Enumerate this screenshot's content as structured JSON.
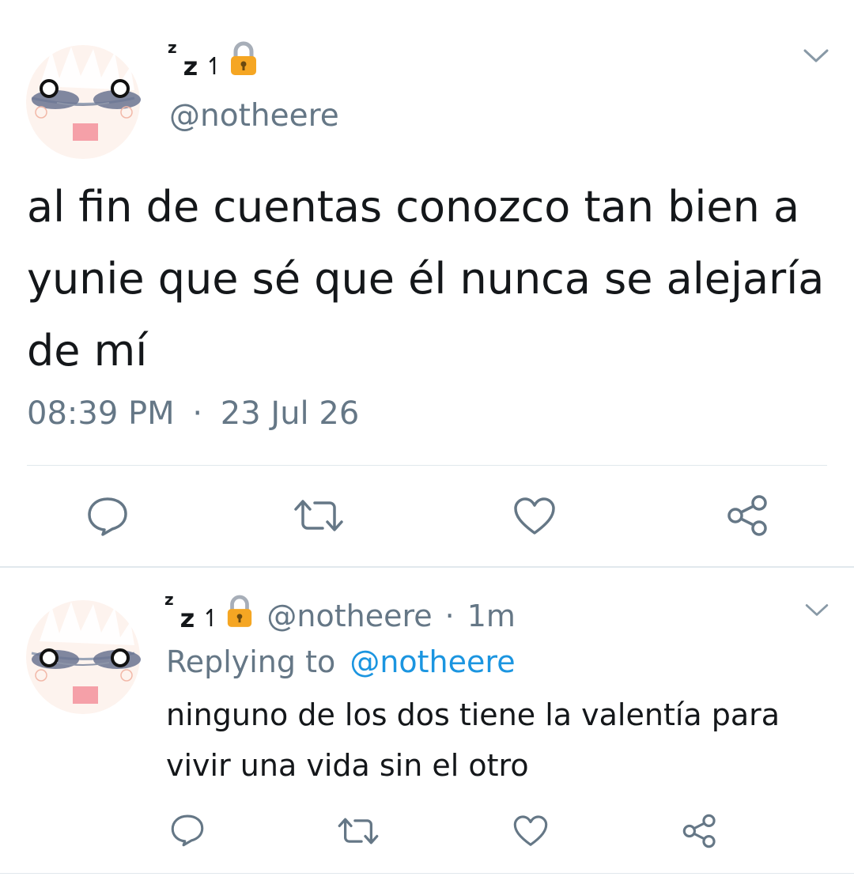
{
  "tweet": {
    "display_name_sup": "z",
    "display_name_main": "z",
    "display_name_arrow": "↿",
    "handle": "@notheere",
    "text": "al fin de cuentas conozco tan bien a yunie que sé que él nunca se alejaría de mí",
    "time": "08:39 PM",
    "separator": "·",
    "date": "23 Jul 26",
    "icons": {
      "menu": "chevron-down-icon",
      "reply": "reply-icon",
      "retweet": "retweet-icon",
      "like": "heart-icon",
      "share": "share-icon"
    }
  },
  "reply": {
    "display_name_sup": "z",
    "display_name_main": "z",
    "display_name_arrow": "↿",
    "handle": "@notheere",
    "separator": "·",
    "time_ago": "1m",
    "replying_prefix": "Replying to",
    "replying_handle": "@notheere",
    "text": "ninguno de los dos tiene la valentía para vivir una vida sin el otro"
  },
  "colors": {
    "text": "#14171a",
    "muted": "#657786",
    "link": "#1b95e0",
    "divider": "#e1e8ed",
    "lock": "#f5a623"
  }
}
